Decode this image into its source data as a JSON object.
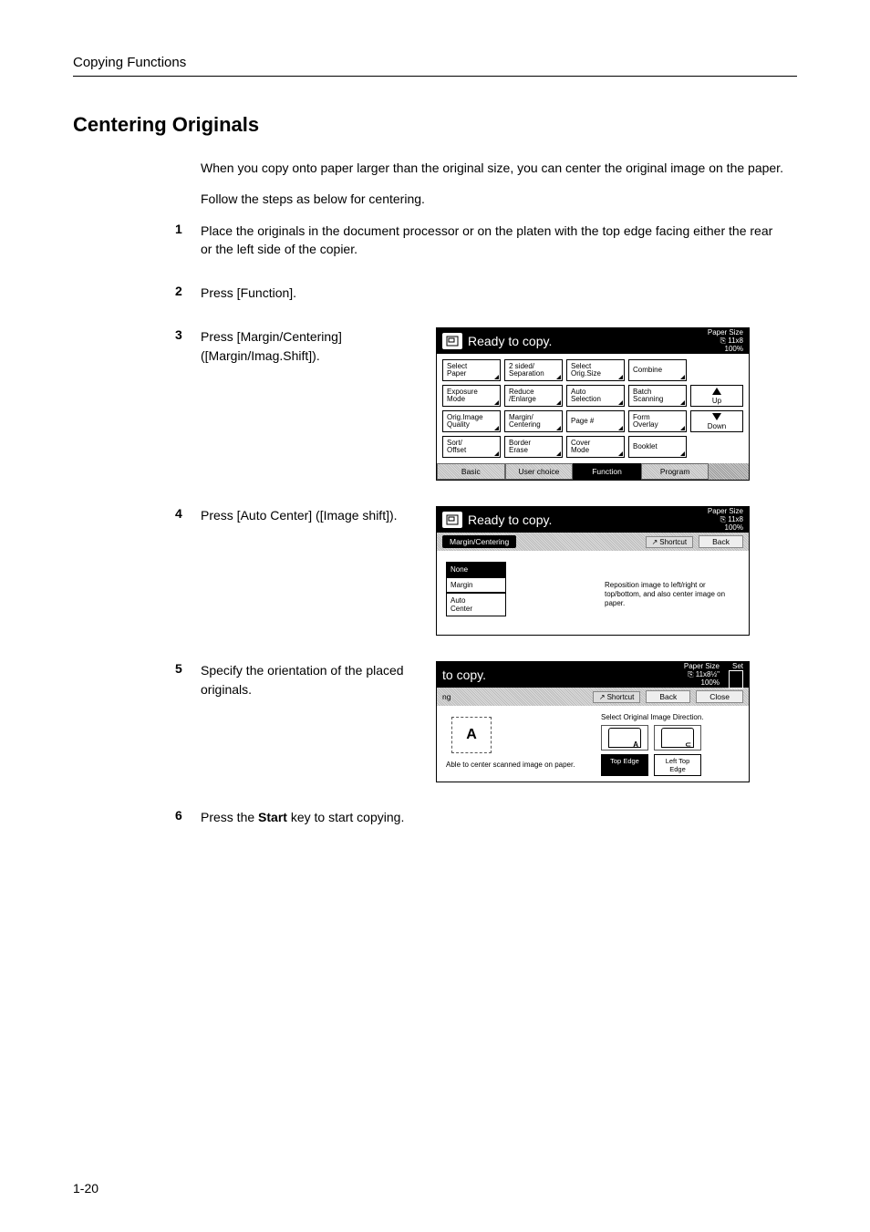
{
  "header": {
    "running": "Copying Functions"
  },
  "title": "Centering Originals",
  "intro": [
    "When you copy onto paper larger than the original size, you can center the original image on the paper.",
    "Follow the steps as below for centering."
  ],
  "steps": [
    {
      "n": "1",
      "text": "Place the originals in the document processor or on the platen with the top edge facing either the rear or the left side of the copier."
    },
    {
      "n": "2",
      "text": "Press [Function]."
    },
    {
      "n": "3",
      "text": "Press [Margin/Centering] ([Margin/Imag.Shift])."
    },
    {
      "n": "4",
      "text": "Press [Auto Center] ([Image shift])."
    },
    {
      "n": "5",
      "text": "Specify the orientation of the placed originals."
    },
    {
      "n": "6",
      "text_prefix": "Press the ",
      "text_bold": "Start",
      "text_suffix": " key to start copying."
    }
  ],
  "panel1": {
    "title": "Ready to copy.",
    "paper_size_label": "Paper Size",
    "paper_size_value": "11x8",
    "zoom": "100%",
    "rows": [
      [
        "Select\nPaper",
        "2 sided/\nSeparation",
        "Select\nOrig.Size",
        "Combine",
        ""
      ],
      [
        "Exposure\nMode",
        "Reduce\n/Enlarge",
        "Auto\nSelection",
        "Batch\nScanning",
        "Up"
      ],
      [
        "Orig.Image\nQuality",
        "Margin/\nCentering",
        "Page #",
        "Form\nOverlay",
        "Down"
      ],
      [
        "Sort/\nOffset",
        "Border\nErase",
        "Cover\nMode",
        "Booklet",
        ""
      ]
    ],
    "tabs": [
      "Basic",
      "User choice",
      "Function",
      "Program"
    ],
    "active_tab": 2
  },
  "panel2": {
    "title": "Ready to copy.",
    "paper_size_label": "Paper Size",
    "paper_size_value": "11x8",
    "zoom": "100%",
    "chip": "Margin/Centering",
    "shortcut": "Shortcut",
    "back": "Back",
    "options": [
      "None",
      "Margin",
      "Auto\nCenter"
    ],
    "selected": 0,
    "desc": "Reposition image to left/right or top/bottom, and also center image on paper."
  },
  "panel3": {
    "title": "to copy.",
    "paper_size_label": "Paper Size",
    "paper_size_value": "11x8½\"",
    "zoom": "100%",
    "set": "Set",
    "ng_label": "ng",
    "shortcut": "Shortcut",
    "back": "Back",
    "close": "Close",
    "left_caption": "Able to center scanned image on paper.",
    "right_heading": "Select Original Image Direction.",
    "orient_labels": [
      "Top Edge",
      "Left Top\nEdge"
    ],
    "orient_selected": 0
  },
  "page_number": "1-20"
}
